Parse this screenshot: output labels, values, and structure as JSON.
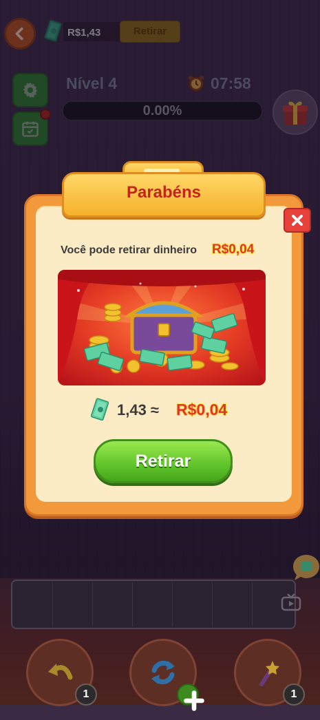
{
  "topbar": {
    "balance": "R$1,43",
    "withdraw_label": "Retirar"
  },
  "level": {
    "label": "Nível 4",
    "timer": "07:58",
    "progress_text": "0.00%",
    "progress_value": 0
  },
  "dialog": {
    "title": "Parabéns",
    "subtitle": "Você pode retirar dinheiro",
    "subtitle_amount": "R$0,04",
    "conversion_value": "1,43 ≈",
    "conversion_amount": "R$0,04",
    "withdraw_button": "Retirar"
  },
  "tools": {
    "undo_count": "1",
    "magic_count": "1"
  },
  "colors": {
    "dialog_orange": "#f29a3b",
    "dialog_cream": "#fbecc6",
    "title_red": "#c4251b",
    "button_green": "#5fc42a",
    "close_red": "#e6413a"
  },
  "icons": [
    "back-arrow-icon",
    "cash-icon",
    "gear-icon",
    "calendar-icon",
    "alarm-clock-icon",
    "gift-icon",
    "close-icon",
    "treasure-chest-image",
    "tv-icon",
    "chat-bubble-icon",
    "undo-icon",
    "shuffle-icon",
    "magic-wand-icon",
    "plus-icon"
  ]
}
